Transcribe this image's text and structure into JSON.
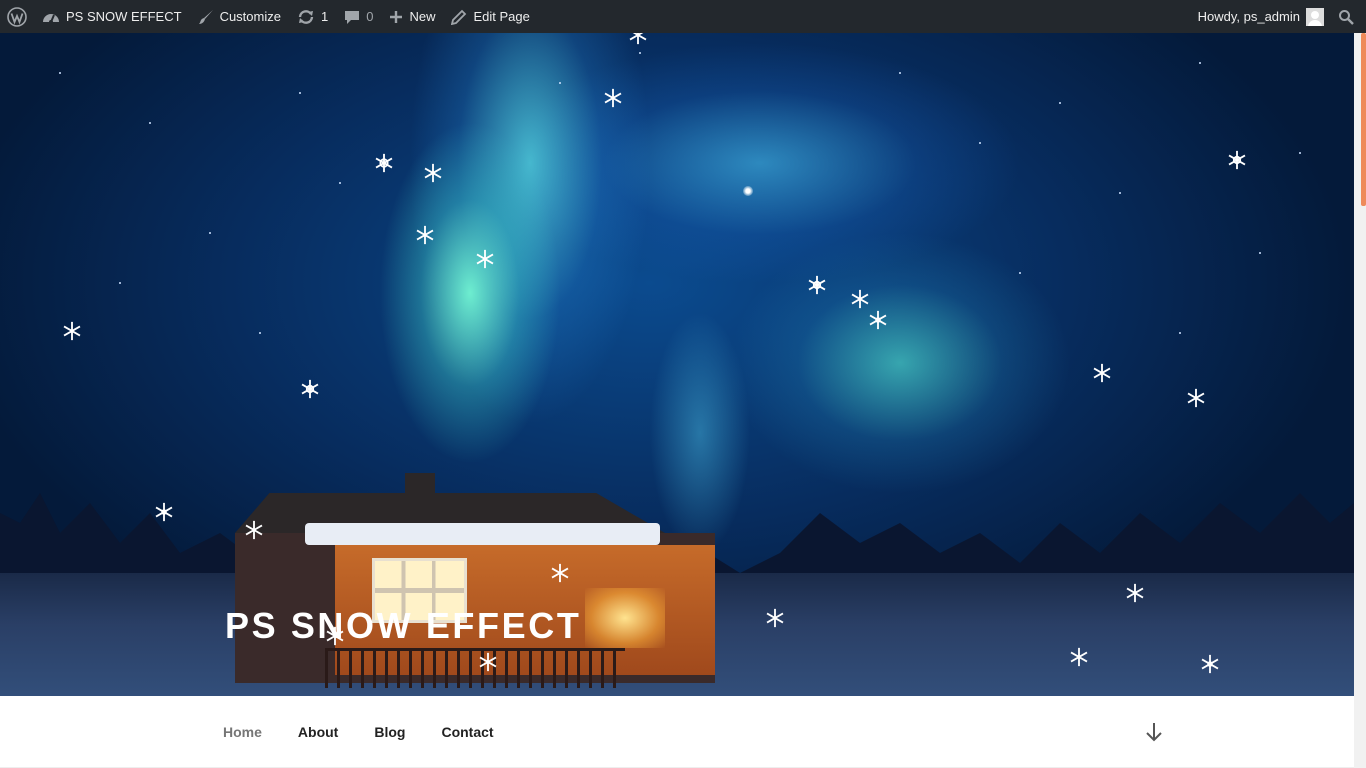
{
  "adminbar": {
    "wp_logo_icon": "wordpress-icon",
    "site_name": "PS SNOW EFFECT",
    "customize_label": "Customize",
    "updates_count": "1",
    "comments_count": "0",
    "new_label": "New",
    "edit_label": "Edit Page",
    "howdy": "Howdy, ps_admin"
  },
  "hero": {
    "site_title": "PS SNOW EFFECT"
  },
  "nav": {
    "items": [
      {
        "label": "Home",
        "current": true
      },
      {
        "label": "About"
      },
      {
        "label": "Blog"
      },
      {
        "label": "Contact"
      }
    ]
  },
  "colors": {
    "adminbar_bg": "#23282d",
    "scroll_thumb": "#ee8a5a",
    "nav_current": "#767676"
  }
}
